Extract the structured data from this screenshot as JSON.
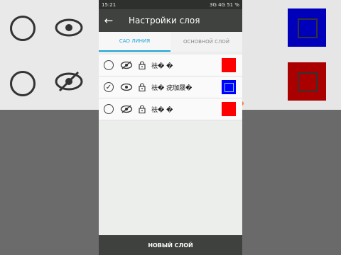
{
  "status": {
    "time": "15:21",
    "right": "3G 4G 51 %"
  },
  "appbar": {
    "back": "←",
    "title": "Настройки слоя"
  },
  "tabs": [
    {
      "label": "CAD ЛИНИЯ",
      "active": true
    },
    {
      "label": "ОСНОВНОЙ СЛОЙ",
      "active": false
    }
  ],
  "layers": [
    {
      "name": "祛� �",
      "selected": false,
      "visible": false,
      "color": "#ff0000"
    },
    {
      "name": "祛� 疣珈屦�",
      "selected": true,
      "visible": true,
      "color": "#0000ff"
    },
    {
      "name": "祛� �",
      "selected": false,
      "visible": false,
      "color": "#ff0000"
    }
  ],
  "check_glyph": "✓",
  "bottom_button": "НОВЫЙ СЛОЙ",
  "icons": {
    "eye": "eye-icon",
    "eye_off": "eye-off-icon",
    "lock": "lock-icon"
  },
  "colors": {
    "accent": "#1fa3d6",
    "appbar": "#40423f",
    "statusbar": "#2e302d"
  }
}
